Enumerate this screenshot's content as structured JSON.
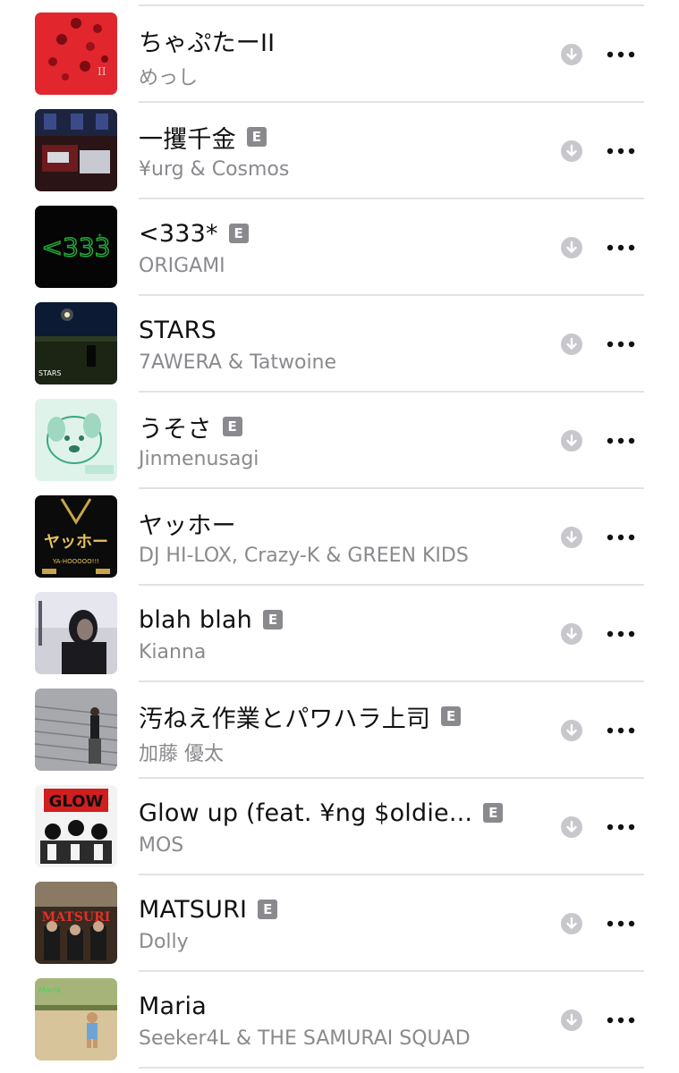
{
  "songs": [
    {
      "title": "ちゃぷたーII",
      "artist": "めっし",
      "explicit": false,
      "art": "red-roses"
    },
    {
      "title": "一攫千金",
      "artist": "¥urg & Cosmos",
      "explicit": true,
      "art": "dark-room"
    },
    {
      "title": "<333*",
      "artist": "ORIGAMI",
      "explicit": true,
      "art": "green-neon"
    },
    {
      "title": "STARS",
      "artist": "7AWERA & Tatwoine",
      "explicit": false,
      "art": "night-sky"
    },
    {
      "title": "うそさ",
      "artist": "Jinmenusagi",
      "explicit": true,
      "art": "dog-sketch"
    },
    {
      "title": "ヤッホー",
      "artist": "DJ HI-LOX, Crazy-K & GREEN KIDS",
      "explicit": false,
      "art": "gold-chain"
    },
    {
      "title": "blah blah",
      "artist": "Kianna",
      "explicit": true,
      "art": "portrait"
    },
    {
      "title": "汚ねえ作業とパワハラ上司",
      "artist": "加藤 優太",
      "explicit": true,
      "art": "stadium"
    },
    {
      "title": "Glow up (feat. ¥ng $oldie...",
      "artist": "MOS",
      "explicit": true,
      "art": "manga"
    },
    {
      "title": "MATSURI",
      "artist": "Dolly",
      "explicit": true,
      "art": "festival"
    },
    {
      "title": "Maria",
      "artist": "Seeker4L & THE SAMURAI SQUAD",
      "explicit": false,
      "art": "child-photo"
    }
  ],
  "explicit_label": "E",
  "colors": {
    "title": "#111111",
    "subtitle": "#8a8a8e",
    "separator": "#e2e2e4",
    "badge": "#8a8a8e",
    "download_icon": "#c7c7cc"
  }
}
